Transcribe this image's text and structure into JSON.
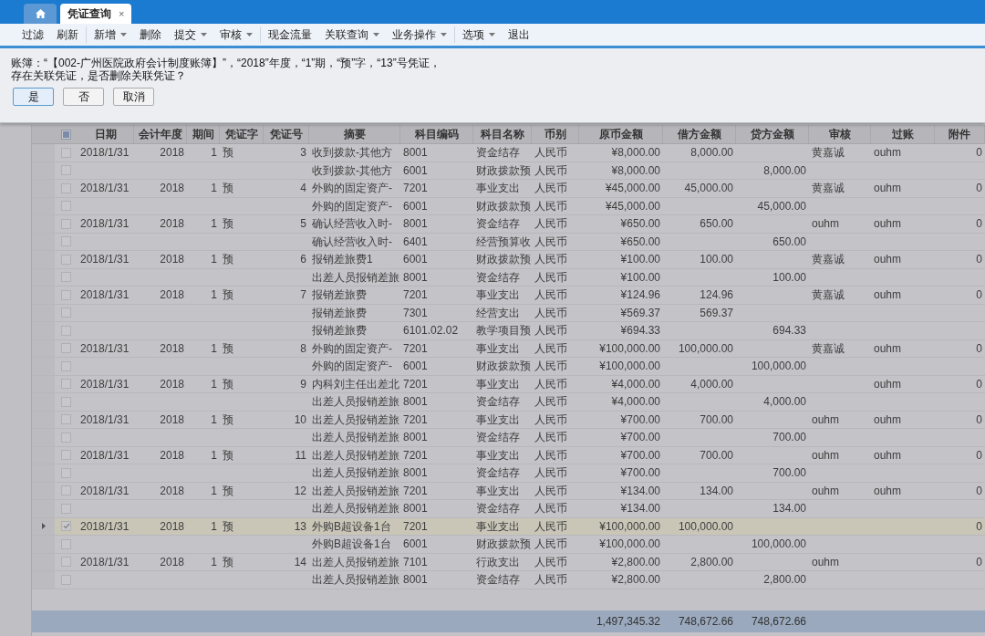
{
  "tabs": [
    {
      "kind": "home",
      "selected": false
    },
    {
      "kind": "text",
      "label": "凭证查询",
      "close": "×",
      "selected": true
    }
  ],
  "toolbar": [
    [
      {
        "label": "过滤",
        "dropdown": false
      },
      {
        "label": "刷新",
        "dropdown": false
      }
    ],
    [
      {
        "label": "新增",
        "dropdown": true
      },
      {
        "label": "删除",
        "dropdown": false
      },
      {
        "label": "提交",
        "dropdown": true
      },
      {
        "label": "审核",
        "dropdown": true
      }
    ],
    [
      {
        "label": "现金流量",
        "dropdown": false
      },
      {
        "label": "关联查询",
        "dropdown": true
      },
      {
        "label": "业务操作",
        "dropdown": true
      }
    ],
    [
      {
        "label": "选项",
        "dropdown": true
      },
      {
        "label": "退出",
        "dropdown": false
      }
    ]
  ],
  "dialog": {
    "message": [
      "账簿：“【002-广州医院政府会计制度账簿】”，“2018”年度，“1”期，“预”字，“13”号凭证，",
      "存在关联凭证，是否删除关联凭证？"
    ],
    "buttons": [
      {
        "label": "是",
        "selected": true
      },
      {
        "label": "否",
        "selected": false
      },
      {
        "label": "取消",
        "selected": false
      }
    ]
  },
  "table": {
    "select_all": {
      "indeterminate": true
    },
    "columns": [
      "日期",
      "会计年度",
      "期间",
      "凭证字",
      "凭证号",
      "摘要",
      "科目编码",
      "科目名称",
      "币别",
      "原币金额",
      "借方金额",
      "贷方金额",
      "审核",
      "过账",
      "附件"
    ],
    "rows": [
      {
        "selected": false,
        "checked": false,
        "cells": [
          "2018/1/31",
          "2018",
          "1",
          "预",
          "3",
          "收到拨款-其他方",
          "8001",
          "资金结存",
          "人民币",
          "¥8,000.00",
          "8,000.00",
          "",
          "黄嘉诚",
          "ouhm",
          "0"
        ]
      },
      {
        "selected": false,
        "checked": false,
        "cells": [
          "",
          "",
          "",
          "",
          "",
          "收到拨款-其他方",
          "6001",
          "财政拨款预",
          "人民币",
          "¥8,000.00",
          "",
          "8,000.00",
          "",
          "",
          ""
        ]
      },
      {
        "selected": false,
        "checked": false,
        "cells": [
          "2018/1/31",
          "2018",
          "1",
          "预",
          "4",
          "外购的固定资产-",
          "7201",
          "事业支出",
          "人民币",
          "¥45,000.00",
          "45,000.00",
          "",
          "黄嘉诚",
          "ouhm",
          "0"
        ]
      },
      {
        "selected": false,
        "checked": false,
        "cells": [
          "",
          "",
          "",
          "",
          "",
          "外购的固定资产-",
          "6001",
          "财政拨款预",
          "人民币",
          "¥45,000.00",
          "",
          "45,000.00",
          "",
          "",
          ""
        ]
      },
      {
        "selected": false,
        "checked": false,
        "cells": [
          "2018/1/31",
          "2018",
          "1",
          "预",
          "5",
          "确认经营收入时-",
          "8001",
          "资金结存",
          "人民币",
          "¥650.00",
          "650.00",
          "",
          "ouhm",
          "ouhm",
          "0"
        ]
      },
      {
        "selected": false,
        "checked": false,
        "cells": [
          "",
          "",
          "",
          "",
          "",
          "确认经营收入时-",
          "6401",
          "经营预算收",
          "人民币",
          "¥650.00",
          "",
          "650.00",
          "",
          "",
          ""
        ]
      },
      {
        "selected": false,
        "checked": false,
        "cells": [
          "2018/1/31",
          "2018",
          "1",
          "预",
          "6",
          "报销差旅费1",
          "6001",
          "财政拨款预",
          "人民币",
          "¥100.00",
          "100.00",
          "",
          "黄嘉诚",
          "ouhm",
          "0"
        ]
      },
      {
        "selected": false,
        "checked": false,
        "cells": [
          "",
          "",
          "",
          "",
          "",
          "出差人员报销差旅",
          "8001",
          "资金结存",
          "人民币",
          "¥100.00",
          "",
          "100.00",
          "",
          "",
          ""
        ]
      },
      {
        "selected": false,
        "checked": false,
        "cells": [
          "2018/1/31",
          "2018",
          "1",
          "预",
          "7",
          "报销差旅费",
          "7201",
          "事业支出",
          "人民币",
          "¥124.96",
          "124.96",
          "",
          "黄嘉诚",
          "ouhm",
          "0"
        ]
      },
      {
        "selected": false,
        "checked": false,
        "cells": [
          "",
          "",
          "",
          "",
          "",
          "报销差旅费",
          "7301",
          "经营支出",
          "人民币",
          "¥569.37",
          "569.37",
          "",
          "",
          "",
          ""
        ]
      },
      {
        "selected": false,
        "checked": false,
        "cells": [
          "",
          "",
          "",
          "",
          "",
          "报销差旅费",
          "6101.02.02",
          "教学项目预",
          "人民币",
          "¥694.33",
          "",
          "694.33",
          "",
          "",
          ""
        ]
      },
      {
        "selected": false,
        "checked": false,
        "cells": [
          "2018/1/31",
          "2018",
          "1",
          "预",
          "8",
          "外购的固定资产-",
          "7201",
          "事业支出",
          "人民币",
          "¥100,000.00",
          "100,000.00",
          "",
          "黄嘉诚",
          "ouhm",
          "0"
        ]
      },
      {
        "selected": false,
        "checked": false,
        "cells": [
          "",
          "",
          "",
          "",
          "",
          "外购的固定资产-",
          "6001",
          "财政拨款预",
          "人民币",
          "¥100,000.00",
          "",
          "100,000.00",
          "",
          "",
          ""
        ]
      },
      {
        "selected": false,
        "checked": false,
        "cells": [
          "2018/1/31",
          "2018",
          "1",
          "预",
          "9",
          "内科刘主任出差北",
          "7201",
          "事业支出",
          "人民币",
          "¥4,000.00",
          "4,000.00",
          "",
          "",
          "ouhm",
          "0"
        ]
      },
      {
        "selected": false,
        "checked": false,
        "cells": [
          "",
          "",
          "",
          "",
          "",
          "出差人员报销差旅",
          "8001",
          "资金结存",
          "人民币",
          "¥4,000.00",
          "",
          "4,000.00",
          "",
          "",
          ""
        ]
      },
      {
        "selected": false,
        "checked": false,
        "cells": [
          "2018/1/31",
          "2018",
          "1",
          "预",
          "10",
          "出差人员报销差旅",
          "7201",
          "事业支出",
          "人民币",
          "¥700.00",
          "700.00",
          "",
          "ouhm",
          "ouhm",
          "0"
        ]
      },
      {
        "selected": false,
        "checked": false,
        "cells": [
          "",
          "",
          "",
          "",
          "",
          "出差人员报销差旅",
          "8001",
          "资金结存",
          "人民币",
          "¥700.00",
          "",
          "700.00",
          "",
          "",
          ""
        ]
      },
      {
        "selected": false,
        "checked": false,
        "cells": [
          "2018/1/31",
          "2018",
          "1",
          "预",
          "11",
          "出差人员报销差旅",
          "7201",
          "事业支出",
          "人民币",
          "¥700.00",
          "700.00",
          "",
          "ouhm",
          "ouhm",
          "0"
        ]
      },
      {
        "selected": false,
        "checked": false,
        "cells": [
          "",
          "",
          "",
          "",
          "",
          "出差人员报销差旅",
          "8001",
          "资金结存",
          "人民币",
          "¥700.00",
          "",
          "700.00",
          "",
          "",
          ""
        ]
      },
      {
        "selected": false,
        "checked": false,
        "cells": [
          "2018/1/31",
          "2018",
          "1",
          "预",
          "12",
          "出差人员报销差旅",
          "7201",
          "事业支出",
          "人民币",
          "¥134.00",
          "134.00",
          "",
          "ouhm",
          "ouhm",
          "0"
        ]
      },
      {
        "selected": false,
        "checked": false,
        "cells": [
          "",
          "",
          "",
          "",
          "",
          "出差人员报销差旅",
          "8001",
          "资金结存",
          "人民币",
          "¥134.00",
          "",
          "134.00",
          "",
          "",
          ""
        ]
      },
      {
        "selected": true,
        "checked": true,
        "cells": [
          "2018/1/31",
          "2018",
          "1",
          "预",
          "13",
          "外购B超设备1台",
          "7201",
          "事业支出",
          "人民币",
          "¥100,000.00",
          "100,000.00",
          "",
          "",
          "",
          "0"
        ]
      },
      {
        "selected": false,
        "checked": false,
        "cells": [
          "",
          "",
          "",
          "",
          "",
          "外购B超设备1台",
          "6001",
          "财政拨款预",
          "人民币",
          "¥100,000.00",
          "",
          "100,000.00",
          "",
          "",
          ""
        ]
      },
      {
        "selected": false,
        "checked": false,
        "cells": [
          "2018/1/31",
          "2018",
          "1",
          "预",
          "14",
          "出差人员报销差旅",
          "7101",
          "行政支出",
          "人民币",
          "¥2,800.00",
          "2,800.00",
          "",
          "ouhm",
          "",
          "0"
        ]
      },
      {
        "selected": false,
        "checked": false,
        "cells": [
          "",
          "",
          "",
          "",
          "",
          "出差人员报销差旅",
          "8001",
          "资金结存",
          "人民币",
          "¥2,800.00",
          "",
          "2,800.00",
          "",
          "",
          ""
        ]
      }
    ],
    "totals": {
      "original_amount": "1,497,345.32",
      "debit": "748,672.66",
      "credit": "748,672.66"
    }
  }
}
